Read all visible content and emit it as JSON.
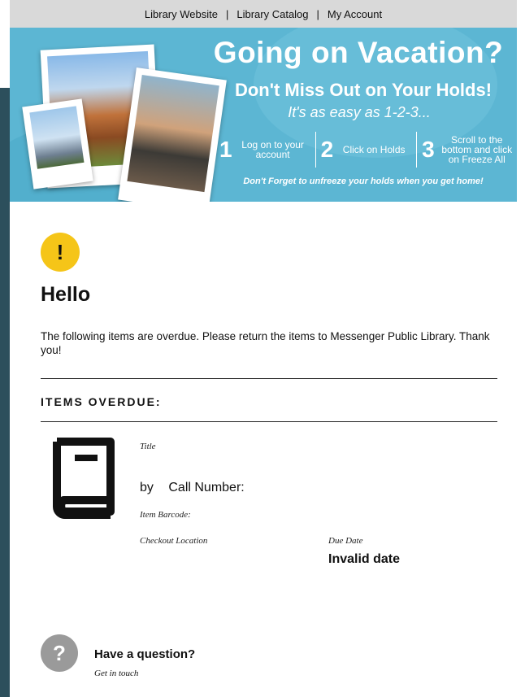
{
  "nav": {
    "links": [
      "Library Website",
      "Library Catalog",
      "My Account"
    ],
    "separator": "|"
  },
  "banner": {
    "title": "Going on Vacation?",
    "subtitle": "Don't Miss Out on Your Holds!",
    "easy": "It's as easy as 1-2-3...",
    "steps": [
      {
        "num": "1",
        "text": "Log on to your account"
      },
      {
        "num": "2",
        "text": "Click on Holds"
      },
      {
        "num": "3",
        "text": "Scroll to the bottom and click on Freeze All"
      }
    ],
    "note": "Don't Forget to unfreeze your holds when you get home!"
  },
  "notice": {
    "alert_symbol": "!",
    "greeting": "Hello",
    "message": "The following items are overdue.  Please return the items to Messenger Public Library.  Thank you!"
  },
  "items_section": {
    "heading": "ITEMS OVERDUE:",
    "item": {
      "icon": "book-icon",
      "title_label": "Title",
      "by_label": "by",
      "call_number_label": "Call Number:",
      "barcode_label": "Item Barcode:",
      "checkout_location_label": "Checkout Location",
      "due_date_label": "Due Date",
      "due_date_value": "Invalid date"
    }
  },
  "question": {
    "symbol": "?",
    "title": "Have a question?",
    "subtitle": "Get in touch"
  },
  "colors": {
    "nav_bg": "#d9d9d9",
    "banner_bg": "#5cb6d3",
    "alert": "#f5c518",
    "question_icon": "#9a9a9a",
    "left_strip": "#2c4f5c"
  }
}
